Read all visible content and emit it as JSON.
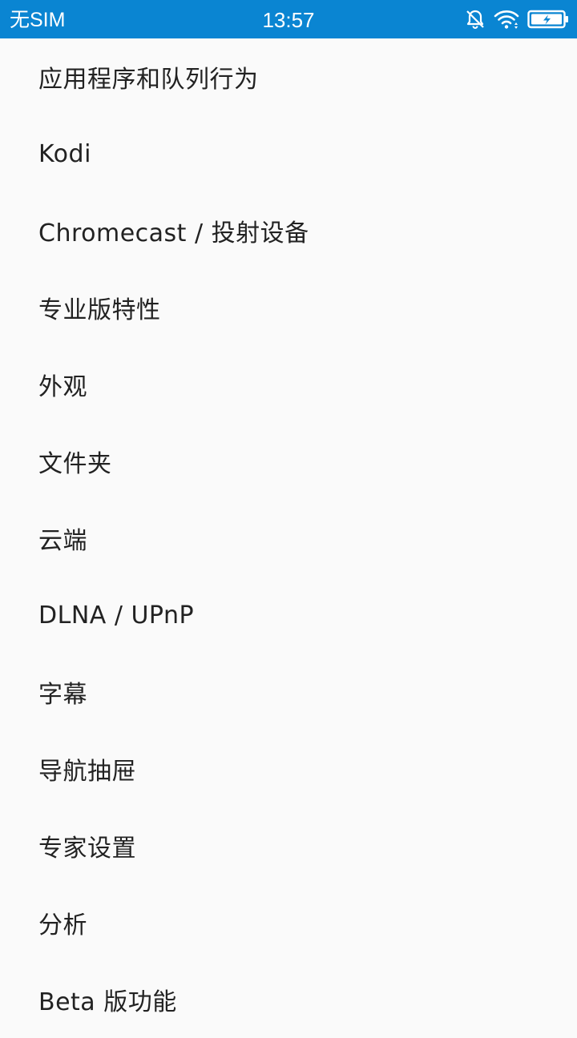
{
  "status_bar": {
    "carrier": "无SIM",
    "time": "13:57",
    "icons": [
      "mute-bell-icon",
      "wifi-icon",
      "battery-charging-icon"
    ],
    "background": "#0a85d2"
  },
  "settings": {
    "items": [
      {
        "label": "应用程序和队列行为"
      },
      {
        "label": "Kodi"
      },
      {
        "label": "Chromecast / 投射设备"
      },
      {
        "label": "专业版特性"
      },
      {
        "label": "外观"
      },
      {
        "label": "文件夹"
      },
      {
        "label": "云端"
      },
      {
        "label": "DLNA / UPnP"
      },
      {
        "label": "字幕"
      },
      {
        "label": "导航抽屉"
      },
      {
        "label": "专家设置"
      },
      {
        "label": "分析"
      },
      {
        "label": "Beta 版功能"
      }
    ]
  }
}
